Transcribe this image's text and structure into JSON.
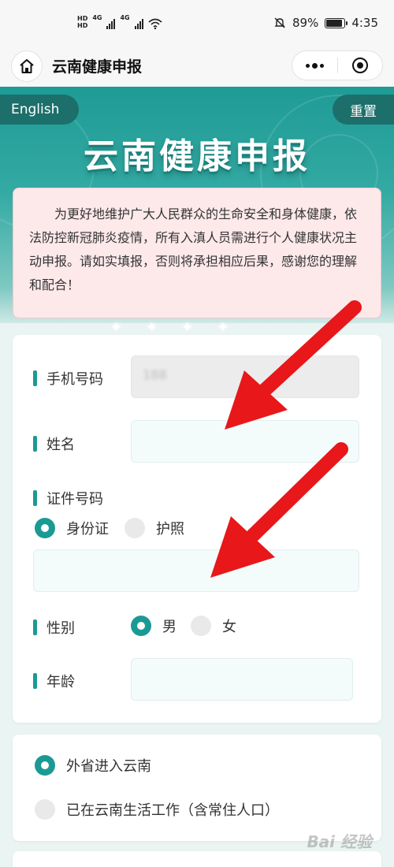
{
  "status_bar": {
    "hd1": "HD",
    "hd2": "HD",
    "net1": "4G",
    "net2": "4G",
    "battery_percent": "89%",
    "battery_level": 0.89,
    "time": "4:35",
    "icons": [
      "signal-icon",
      "wifi-icon",
      "mute-bell-icon",
      "battery-icon"
    ]
  },
  "title_bar": {
    "title": "云南健康申报",
    "icons": [
      "home-icon",
      "more-dots-icon",
      "close-target-icon"
    ]
  },
  "banner": {
    "language_button": "English",
    "reset_button": "重置",
    "title": "云南健康申报"
  },
  "notice": {
    "text": "为更好地维护广大人民群众的生命安全和身体健康，依法防控新冠肺炎疫情，所有入滇人员需进行个人健康状况主动申报。请如实填报，否则将承担相应后果，感谢您的理解和配合！"
  },
  "decoration": {
    "sparkles": "✦✦✦✦"
  },
  "form": {
    "phone_label": "手机号码",
    "phone_value": "188",
    "name_label": "姓名",
    "name_value": "",
    "id_label": "证件号码",
    "id_types": [
      {
        "label": "身份证",
        "selected": true
      },
      {
        "label": "护照",
        "selected": false
      }
    ],
    "id_value": "",
    "gender_label": "性别",
    "genders": [
      {
        "label": "男",
        "selected": true
      },
      {
        "label": "女",
        "selected": false
      }
    ],
    "age_label": "年龄",
    "age_value": ""
  },
  "entry": {
    "options": [
      {
        "label": "外省进入云南",
        "selected": true
      },
      {
        "label": "已在云南生活工作（含常住人口）",
        "selected": false
      }
    ]
  },
  "colors": {
    "accent": "#1b9a94",
    "notice_bg": "#fde8ea",
    "arrow": "#e8171a"
  },
  "watermark": "Bai 经验"
}
